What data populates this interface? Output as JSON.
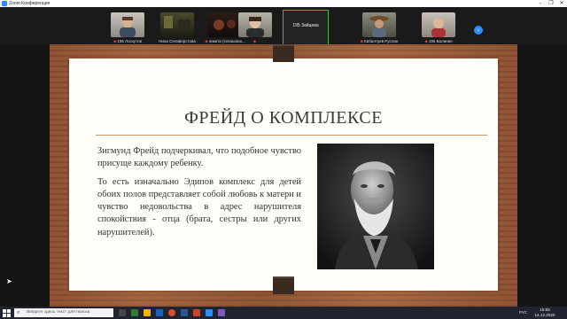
{
  "window": {
    "title": "Zoom Конференция",
    "controls": [
      "–",
      "❐",
      "✕"
    ]
  },
  "gallery": {
    "tiles": [
      {
        "name": "195 Лоскутов"
      },
      {
        "name": "Нина Селиверстова"
      },
      {
        "name": "никита (телаковск..."
      },
      {
        "name": "195 Зайцева"
      },
      {
        "name": "Кабалтуев Руслан"
      },
      {
        "name": "195 Балинин"
      }
    ],
    "next_label": "›"
  },
  "slide": {
    "title": "ФРЕЙД О КОМПЛЕКСЕ",
    "paragraphs": [
      "Зигмунд Фрейд подчеркивал, что подобное чувство присуще каждому ребенку.",
      "То есть изначально Эдипов комплекс для детей обоих полов представляет собой любовь к матери и чувство недовольства в адрес нарушителя спокойствия - отца (брата, сестры или других нарушителей)."
    ]
  },
  "taskbar": {
    "search_placeholder": "Введите здесь текст для поиска",
    "tray_lang": "РУС",
    "time": "16:55",
    "date": "14.12.2020"
  },
  "colors": {
    "accent_blue": "#2d8cff",
    "board_brown": "#9a5a35",
    "rule": "#c89a72",
    "active_tile_border": "#4caf50"
  }
}
